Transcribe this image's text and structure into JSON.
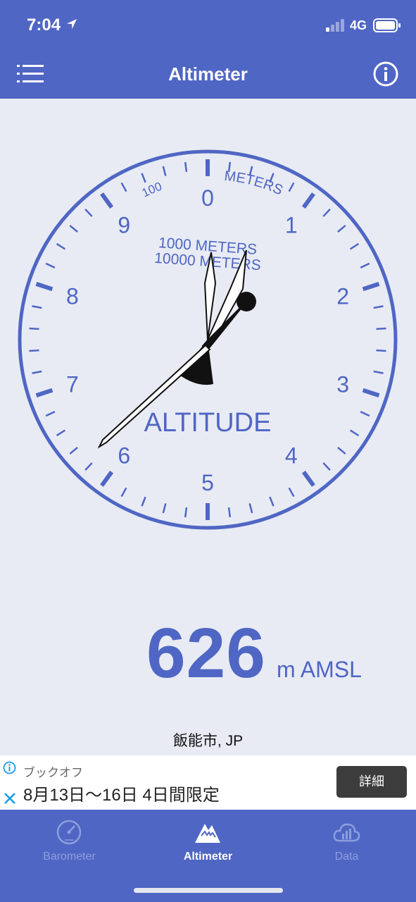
{
  "status": {
    "time": "7:04",
    "network": "4G"
  },
  "nav": {
    "title": "Altimeter",
    "menu_icon": "hamburger-menu-icon",
    "info_icon": "info-icon"
  },
  "gauge": {
    "numbers": [
      "0",
      "1",
      "2",
      "3",
      "4",
      "5",
      "6",
      "7",
      "8",
      "9"
    ],
    "label_meters": "METERS",
    "label_100": "100",
    "label_1000": "1000 METERS",
    "label_10000": "10000 METERS",
    "label_altitude": "ALTITUDE",
    "hand_units_meters": 626,
    "colors": {
      "accent": "#4f66c4",
      "hand": "#111111",
      "hand_fill": "#ffffff"
    }
  },
  "readout": {
    "value": "626",
    "unit": "m AMSL"
  },
  "location": "飯能市, JP",
  "ad": {
    "advertiser": "ブックオフ",
    "headline": "8月13日〜16日 4日間限定",
    "button": "詳細"
  },
  "tabs": [
    {
      "label": "Barometer",
      "icon": "barometer-gauge-icon",
      "active": false
    },
    {
      "label": "Altimeter",
      "icon": "mountain-icon",
      "active": true
    },
    {
      "label": "Data",
      "icon": "cloud-chart-icon",
      "active": false
    }
  ]
}
